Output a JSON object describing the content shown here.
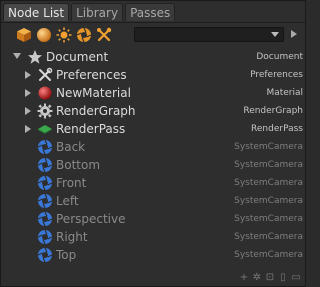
{
  "tabs": [
    {
      "label": "Node List",
      "active": true
    },
    {
      "label": "Library",
      "active": false
    },
    {
      "label": "Passes",
      "active": false
    }
  ],
  "toolbar": {
    "icons": [
      "box-icon",
      "sphere-icon",
      "sun-icon",
      "aperture-icon",
      "tools-icon"
    ],
    "dropdown_value": ""
  },
  "tree": {
    "root": {
      "name": "Document",
      "type": "Document"
    },
    "children": [
      {
        "name": "Preferences",
        "type": "Preferences",
        "icon": "wrench-icon",
        "expandable": true
      },
      {
        "name": "NewMaterial",
        "type": "Material",
        "icon": "material-sphere-icon",
        "expandable": true
      },
      {
        "name": "RenderGraph",
        "type": "RenderGraph",
        "icon": "gear-icon",
        "expandable": true
      },
      {
        "name": "RenderPass",
        "type": "RenderPass",
        "icon": "pass-icon",
        "expandable": true
      }
    ],
    "cameras": [
      {
        "name": "Back",
        "type": "SystemCamera"
      },
      {
        "name": "Bottom",
        "type": "SystemCamera"
      },
      {
        "name": "Front",
        "type": "SystemCamera"
      },
      {
        "name": "Left",
        "type": "SystemCamera"
      },
      {
        "name": "Perspective",
        "type": "SystemCamera"
      },
      {
        "name": "Right",
        "type": "SystemCamera"
      },
      {
        "name": "Top",
        "type": "SystemCamera"
      }
    ]
  },
  "colors": {
    "accent_orange": "#e8962a",
    "camera_blue": "#3a78d8",
    "material_red": "#c42020",
    "pass_green": "#3aa84a"
  }
}
